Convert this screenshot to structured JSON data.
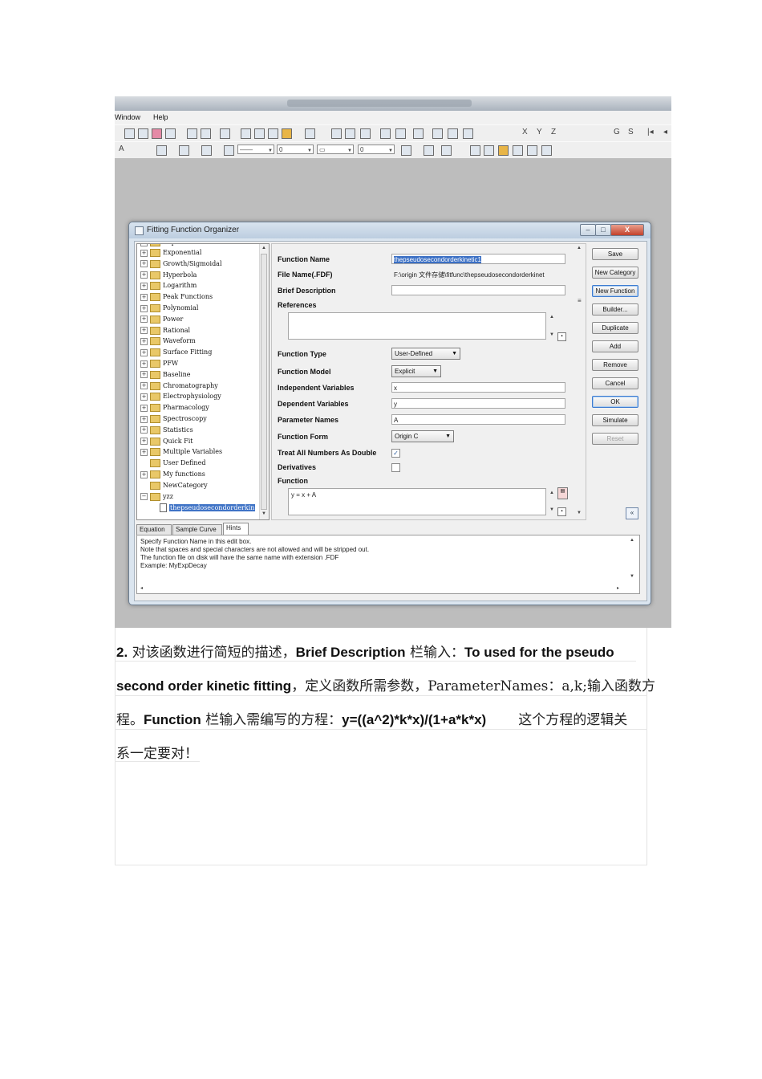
{
  "app": {
    "menu": [
      "Window",
      "Help"
    ],
    "toolbar2_values": [
      "0",
      "0"
    ]
  },
  "dialog": {
    "title": "Fitting Function Organizer",
    "window_buttons": [
      "–",
      "□",
      "X"
    ],
    "tree": [
      {
        "label": "Exponential",
        "kind": "folder",
        "expander": "+"
      },
      {
        "label": "Growth/Sigmoidal",
        "kind": "folder",
        "expander": "+"
      },
      {
        "label": "Hyperbola",
        "kind": "folder",
        "expander": "+"
      },
      {
        "label": "Logarithm",
        "kind": "folder",
        "expander": "+"
      },
      {
        "label": "Peak Functions",
        "kind": "folder",
        "expander": "+"
      },
      {
        "label": "Polynomial",
        "kind": "folder",
        "expander": "+"
      },
      {
        "label": "Power",
        "kind": "folder",
        "expander": "+"
      },
      {
        "label": "Rational",
        "kind": "folder",
        "expander": "+"
      },
      {
        "label": "Waveform",
        "kind": "folder",
        "expander": "+"
      },
      {
        "label": "Surface Fitting",
        "kind": "folder",
        "expander": "+"
      },
      {
        "label": "PFW",
        "kind": "folder",
        "expander": "+"
      },
      {
        "label": "Baseline",
        "kind": "folder",
        "expander": "+"
      },
      {
        "label": "Chromatography",
        "kind": "folder",
        "expander": "+"
      },
      {
        "label": "Electrophysiology",
        "kind": "folder",
        "expander": "+"
      },
      {
        "label": "Pharmacology",
        "kind": "folder",
        "expander": "+"
      },
      {
        "label": "Spectroscopy",
        "kind": "folder",
        "expander": "+"
      },
      {
        "label": "Statistics",
        "kind": "folder",
        "expander": "+"
      },
      {
        "label": "Quick Fit",
        "kind": "folder",
        "expander": "+"
      },
      {
        "label": "Multiple Variables",
        "kind": "folder",
        "expander": "+"
      },
      {
        "label": "User Defined",
        "kind": "folder",
        "expander": ""
      },
      {
        "label": "My functions",
        "kind": "folder",
        "expander": "+"
      },
      {
        "label": "NewCategory",
        "kind": "folder",
        "expander": ""
      },
      {
        "label": "yzz",
        "kind": "folder",
        "expander": "−"
      },
      {
        "label": "thepseudosecondorderkin",
        "kind": "doc",
        "expander": "",
        "selected": true
      }
    ],
    "fields": {
      "function_name_label": "Function Name",
      "function_name_value": "thepseudosecondorderkinetic1",
      "file_name_label": "File Name(.FDF)",
      "file_name_value": "F:\\origin 文件存储\\fitfunc\\thepseudosecondorderkinet",
      "brief_description_label": "Brief Description",
      "brief_description_value": "",
      "references_label": "References",
      "function_type_label": "Function Type",
      "function_type_value": "User-Defined",
      "function_model_label": "Function Model",
      "function_model_value": "Explicit",
      "independent_label": "Independent Variables",
      "independent_value": "x",
      "dependent_label": "Dependent Variables",
      "dependent_value": "y",
      "parameter_label": "Parameter Names",
      "parameter_value": "A",
      "function_form_label": "Function Form",
      "function_form_value": "Origin C",
      "treat_double_label": "Treat All Numbers As Double",
      "treat_double_checked": true,
      "derivatives_label": "Derivatives",
      "derivatives_checked": false,
      "function_label": "Function",
      "function_value": "y = x + A"
    },
    "buttons": [
      "Save",
      "New Category",
      "New Function",
      "Builder...",
      "Duplicate",
      "Add",
      "Remove",
      "Cancel",
      "OK",
      "Simulate",
      "Reset"
    ],
    "collapse_symbol": "«",
    "tabs": [
      "Equation",
      "Sample Curve",
      "Hints"
    ],
    "active_tab": "Hints",
    "hints": [
      "Specify Function Name in this edit box.",
      "Note that spaces and special characters are not allowed and will be stripped out.",
      "The function file on disk will have the same name with extension .FDF",
      "Example: MyExpDecay"
    ]
  },
  "document": {
    "line1_num": "2.",
    "line1_a": " 对该函数进行简短的描述，",
    "line1_b": "Brief Description",
    "line1_c": " 栏输入：",
    "line1_d": "To used for the pseudo",
    "line2_a": "second order kinetic fitting",
    "line2_b": "，定义函数所需参数，ParameterNames：a,k;输入函数方",
    "line3_a": "程。",
    "line3_b": "Function",
    "line3_c": " 栏输入需编写的方程：",
    "line3_d": "y=((a^2)*k*x)/(1+a*k*x)",
    "line3_e": "这个方程的逻辑关",
    "line4": "系一定要对！"
  }
}
